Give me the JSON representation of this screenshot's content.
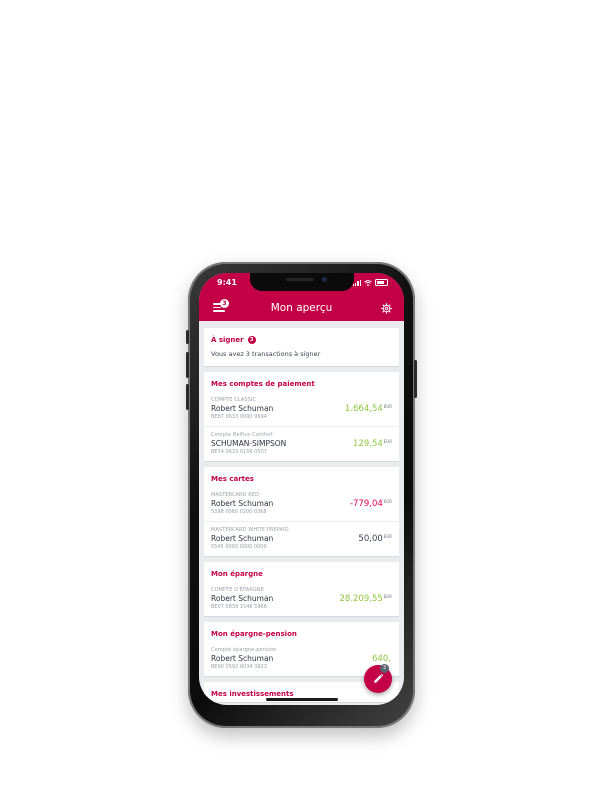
{
  "status_bar": {
    "time": "9:41"
  },
  "header": {
    "title": "Mon aperçu",
    "menu_badge": "3"
  },
  "to_sign": {
    "title": "À signer",
    "count": "3",
    "text": "Vous avez 3 transactions à signer"
  },
  "payment_accounts": {
    "title": "Mes comptes de paiement",
    "items": [
      {
        "type": "COMPTE CLASSIC",
        "holder": "Robert Schuman",
        "number": "BE87 0633 0090 9694",
        "amount": "1.664,54",
        "currency": "EUR"
      },
      {
        "type": "Compte Belfius Comfort",
        "holder": "SCHUMAN-SIMPSON",
        "number": "BE74 0633 0156 0507",
        "amount": "129,54",
        "currency": "EUR"
      }
    ]
  },
  "cards": {
    "title": "Mes cartes",
    "items": [
      {
        "type": "MASTERCARD RED",
        "holder": "Robert Schuman",
        "number": "5398 0060 0200 0368",
        "amount": "-779,04",
        "currency": "EUR"
      },
      {
        "type": "MASTERCARD WHITE PREPAID",
        "holder": "Robert Schuman",
        "number": "5545 0000 0000 0000",
        "amount": "50,00",
        "currency": "EUR"
      }
    ]
  },
  "savings": {
    "title": "Mon épargne",
    "items": [
      {
        "type": "COMPTE D'ÉPARGNE",
        "holder": "Robert Schuman",
        "number": "BE07 0839 1546 5966",
        "amount": "28.209,55",
        "currency": "EUR"
      }
    ]
  },
  "pension": {
    "title": "Mon épargne-pension",
    "items": [
      {
        "type": "Compte épargne-pension",
        "holder": "Robert Schuman",
        "number": "BE90 0592 0034 3923",
        "amount": "640,",
        "currency": ""
      }
    ]
  },
  "investments": {
    "title": "Mes investissements"
  },
  "fab": {
    "badge": "3",
    "icon": "pen-icon"
  },
  "colors": {
    "brand": "#c30045",
    "positive": "#8dc63f",
    "negative": "#e0004d"
  }
}
